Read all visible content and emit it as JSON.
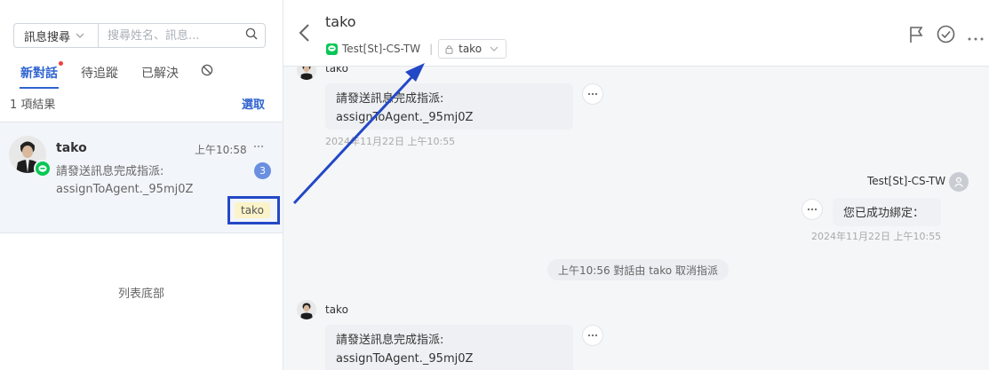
{
  "sidebar": {
    "filter_label": "訊息搜尋",
    "search_placeholder": "搜尋姓名、訊息...",
    "tabs": [
      {
        "label": "新對話"
      },
      {
        "label": "待追蹤"
      },
      {
        "label": "已解決"
      }
    ],
    "result_count": "1 項結果",
    "select_label": "選取",
    "conversation": {
      "name": "tako",
      "time": "上午10:58",
      "preview_line1": "請發送訊息完成指派:",
      "preview_line2": "assignToAgent._95mj0Z",
      "unread": "3",
      "tag": "tako"
    },
    "list_end": "列表底部"
  },
  "header": {
    "name": "tako",
    "channel": "Test[St]-CS-TW",
    "separator": "|",
    "assignee": "tako"
  },
  "messages": {
    "m1": {
      "sender": "tako",
      "line1": "請發送訊息完成指派:",
      "line2": "assignToAgent._95mj0Z",
      "time": "2024年11月22日 上午10:55"
    },
    "m2": {
      "sender": "Test[St]-CS-TW",
      "text": "您已成功綁定：",
      "time": "2024年11月22日 上午10:55"
    },
    "system": "上午10:56 對話由 tako 取消指派",
    "m3": {
      "sender": "tako",
      "line1": "請發送訊息完成指派:",
      "line2": "assignToAgent._95mj0Z"
    },
    "more_label": "···"
  },
  "icons": {
    "line": "line-icon",
    "search": "search-icon",
    "back": "back-arrow-icon",
    "flag": "flag-icon",
    "check": "check-circle-icon",
    "more": "more-icon",
    "lock": "lock-icon",
    "ban": "ban-icon",
    "agent": "user-icon"
  },
  "colors": {
    "accent": "#2f63d0",
    "line_green": "#06c755",
    "annotation_blue": "#2348c6",
    "unread_badge": "#6a8fe0",
    "tag_bg": "#fbf3c9"
  }
}
